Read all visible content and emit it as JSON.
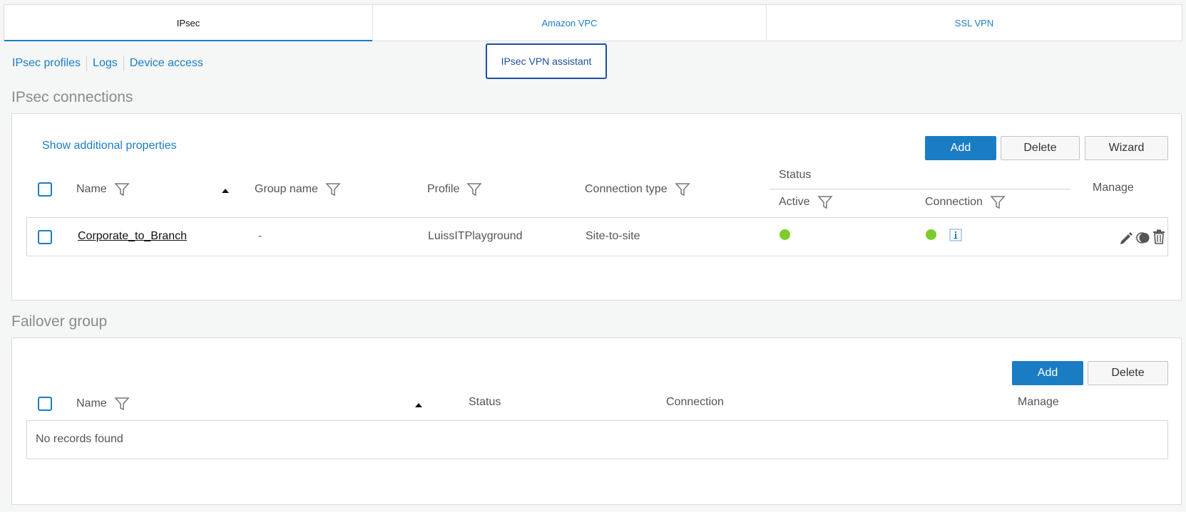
{
  "tabs": [
    {
      "label": "IPsec",
      "active": true
    },
    {
      "label": "Amazon VPC",
      "active": false
    },
    {
      "label": "SSL VPN",
      "active": false
    }
  ],
  "sublinks": [
    "IPsec profiles",
    "Logs",
    "Device access"
  ],
  "assistant_button": "IPsec VPN assistant",
  "ipsec": {
    "title": "IPsec connections",
    "show_props": "Show additional properties",
    "buttons": {
      "add": "Add",
      "delete": "Delete",
      "wizard": "Wizard"
    },
    "headers": {
      "name": "Name",
      "group": "Group name",
      "profile": "Profile",
      "conn_type": "Connection type",
      "status": "Status",
      "active": "Active",
      "connection": "Connection",
      "manage": "Manage"
    },
    "rows": [
      {
        "name": "Corporate_to_Branch",
        "group": "-",
        "profile": "LuissITPlayground",
        "conn_type": "Site-to-site",
        "active_status": "green",
        "connection_status": "green"
      }
    ]
  },
  "failover": {
    "title": "Failover group",
    "buttons": {
      "add": "Add",
      "delete": "Delete"
    },
    "headers": {
      "name": "Name",
      "status": "Status",
      "connection": "Connection",
      "manage": "Manage"
    },
    "empty": "No records found"
  },
  "colors": {
    "accent": "#1a7dc4",
    "status_green": "#7ccd2c",
    "assistant_border": "#1c4fa0"
  }
}
